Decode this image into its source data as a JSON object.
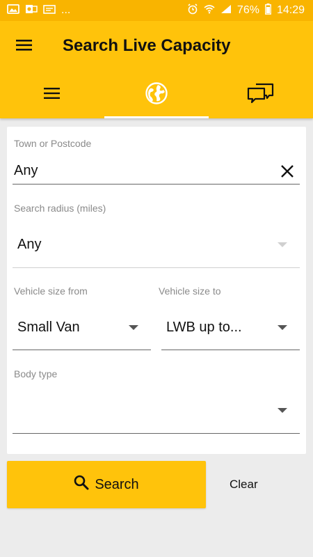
{
  "status_bar": {
    "notification_icons": [
      "image-icon",
      "outlook-icon",
      "reminder-icon"
    ],
    "overflow": "...",
    "battery_percent": "76%",
    "time": "14:29"
  },
  "app_bar": {
    "title": "Search Live Capacity",
    "tabs": [
      {
        "icon": "list-icon",
        "active": false
      },
      {
        "icon": "globe-icon",
        "active": true
      },
      {
        "icon": "chat-icon",
        "active": false
      }
    ]
  },
  "form": {
    "location": {
      "label": "Town or Postcode",
      "value": "Any"
    },
    "radius": {
      "label": "Search radius (miles)",
      "value": "Any"
    },
    "size_from": {
      "label": "Vehicle size from",
      "value": "Small Van"
    },
    "size_to": {
      "label": "Vehicle size to",
      "value": "LWB up to..."
    },
    "body_type": {
      "label": "Body type",
      "value": ""
    }
  },
  "actions": {
    "search_label": "Search",
    "clear_label": "Clear"
  },
  "colors": {
    "accent": "#ffc30b",
    "status_bar": "#f9b400"
  }
}
